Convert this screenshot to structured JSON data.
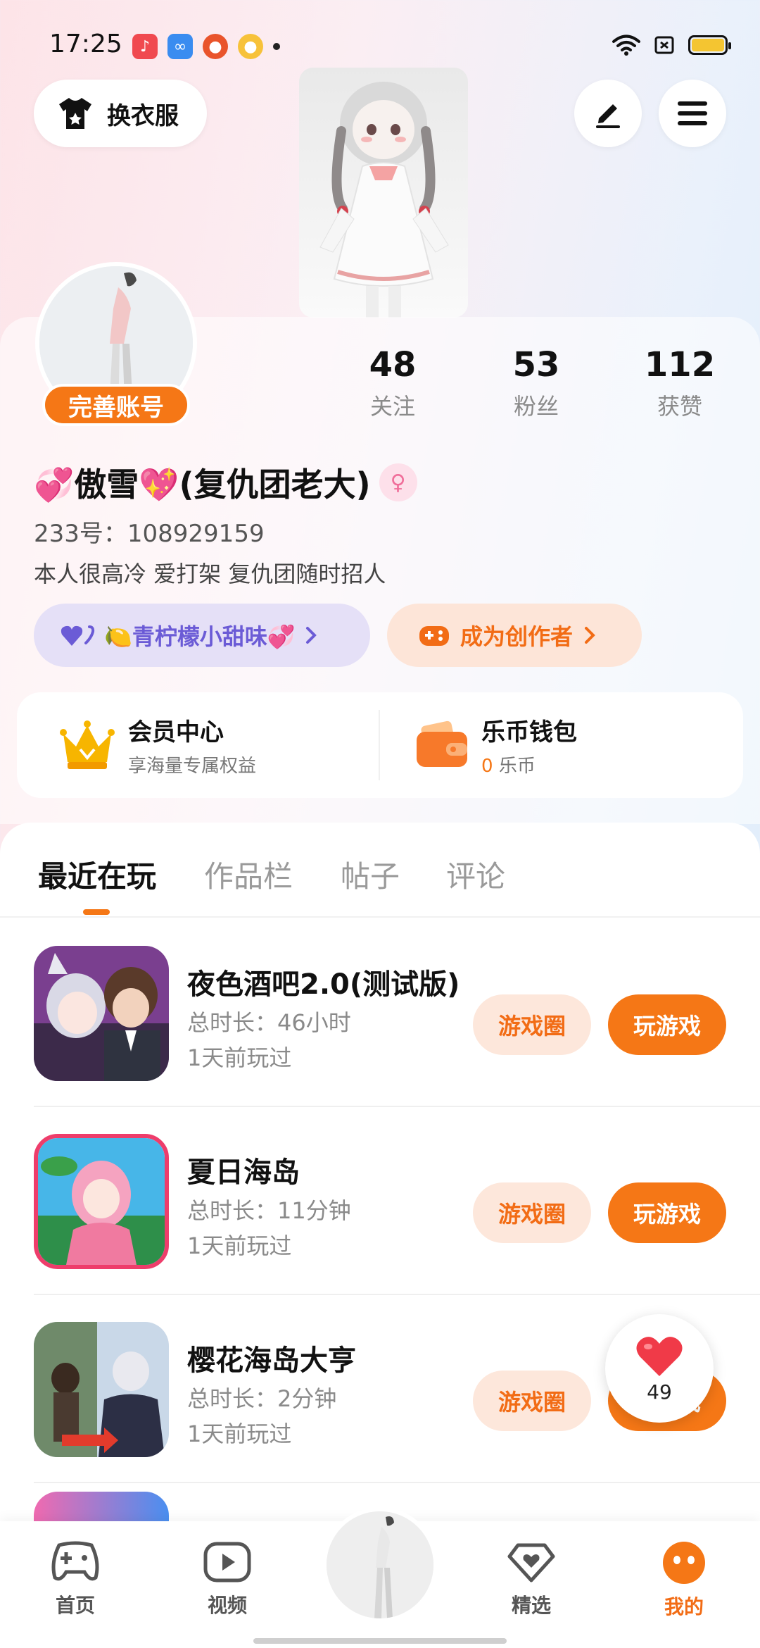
{
  "status_bar": {
    "time": "17:25"
  },
  "header": {
    "outfit_button": "换衣服"
  },
  "profile": {
    "complete_badge": "完善账号",
    "stats": [
      {
        "value": "48",
        "label": "关注"
      },
      {
        "value": "53",
        "label": "粉丝"
      },
      {
        "value": "112",
        "label": "获赞"
      }
    ],
    "nickname": "💞傲雪💖(复仇团老大)",
    "uid": "233号：108929159",
    "bio": "本人很高冷 爱打架 复仇团随时招人",
    "tag_purple": "🍋青柠檬小甜味💞",
    "tag_orange": "成为创作者"
  },
  "wallet": {
    "vip_title": "会员中心",
    "vip_sub": "享海量专属权益",
    "coin_title": "乐币钱包",
    "coin_amount": "0",
    "coin_unit": "乐币"
  },
  "tabs": [
    "最近在玩",
    "作品栏",
    "帖子",
    "评论"
  ],
  "games": [
    {
      "title": "夜色酒吧2.0(测试版)",
      "duration": "总时长：46小时",
      "last_played": "1天前玩过"
    },
    {
      "title": "夏日海岛",
      "duration": "总时长：11分钟",
      "last_played": "1天前玩过"
    },
    {
      "title": "樱花海岛大亨",
      "duration": "总时长：2分钟",
      "last_played": "1天前玩过"
    }
  ],
  "buttons": {
    "circle": "游戏圈",
    "play": "玩游戏"
  },
  "heart_fab": {
    "count": "49"
  },
  "bottom_nav": [
    "首页",
    "视频",
    "精选",
    "我的"
  ],
  "colors": {
    "accent": "#f57716",
    "purple": "#6b5bd6"
  }
}
